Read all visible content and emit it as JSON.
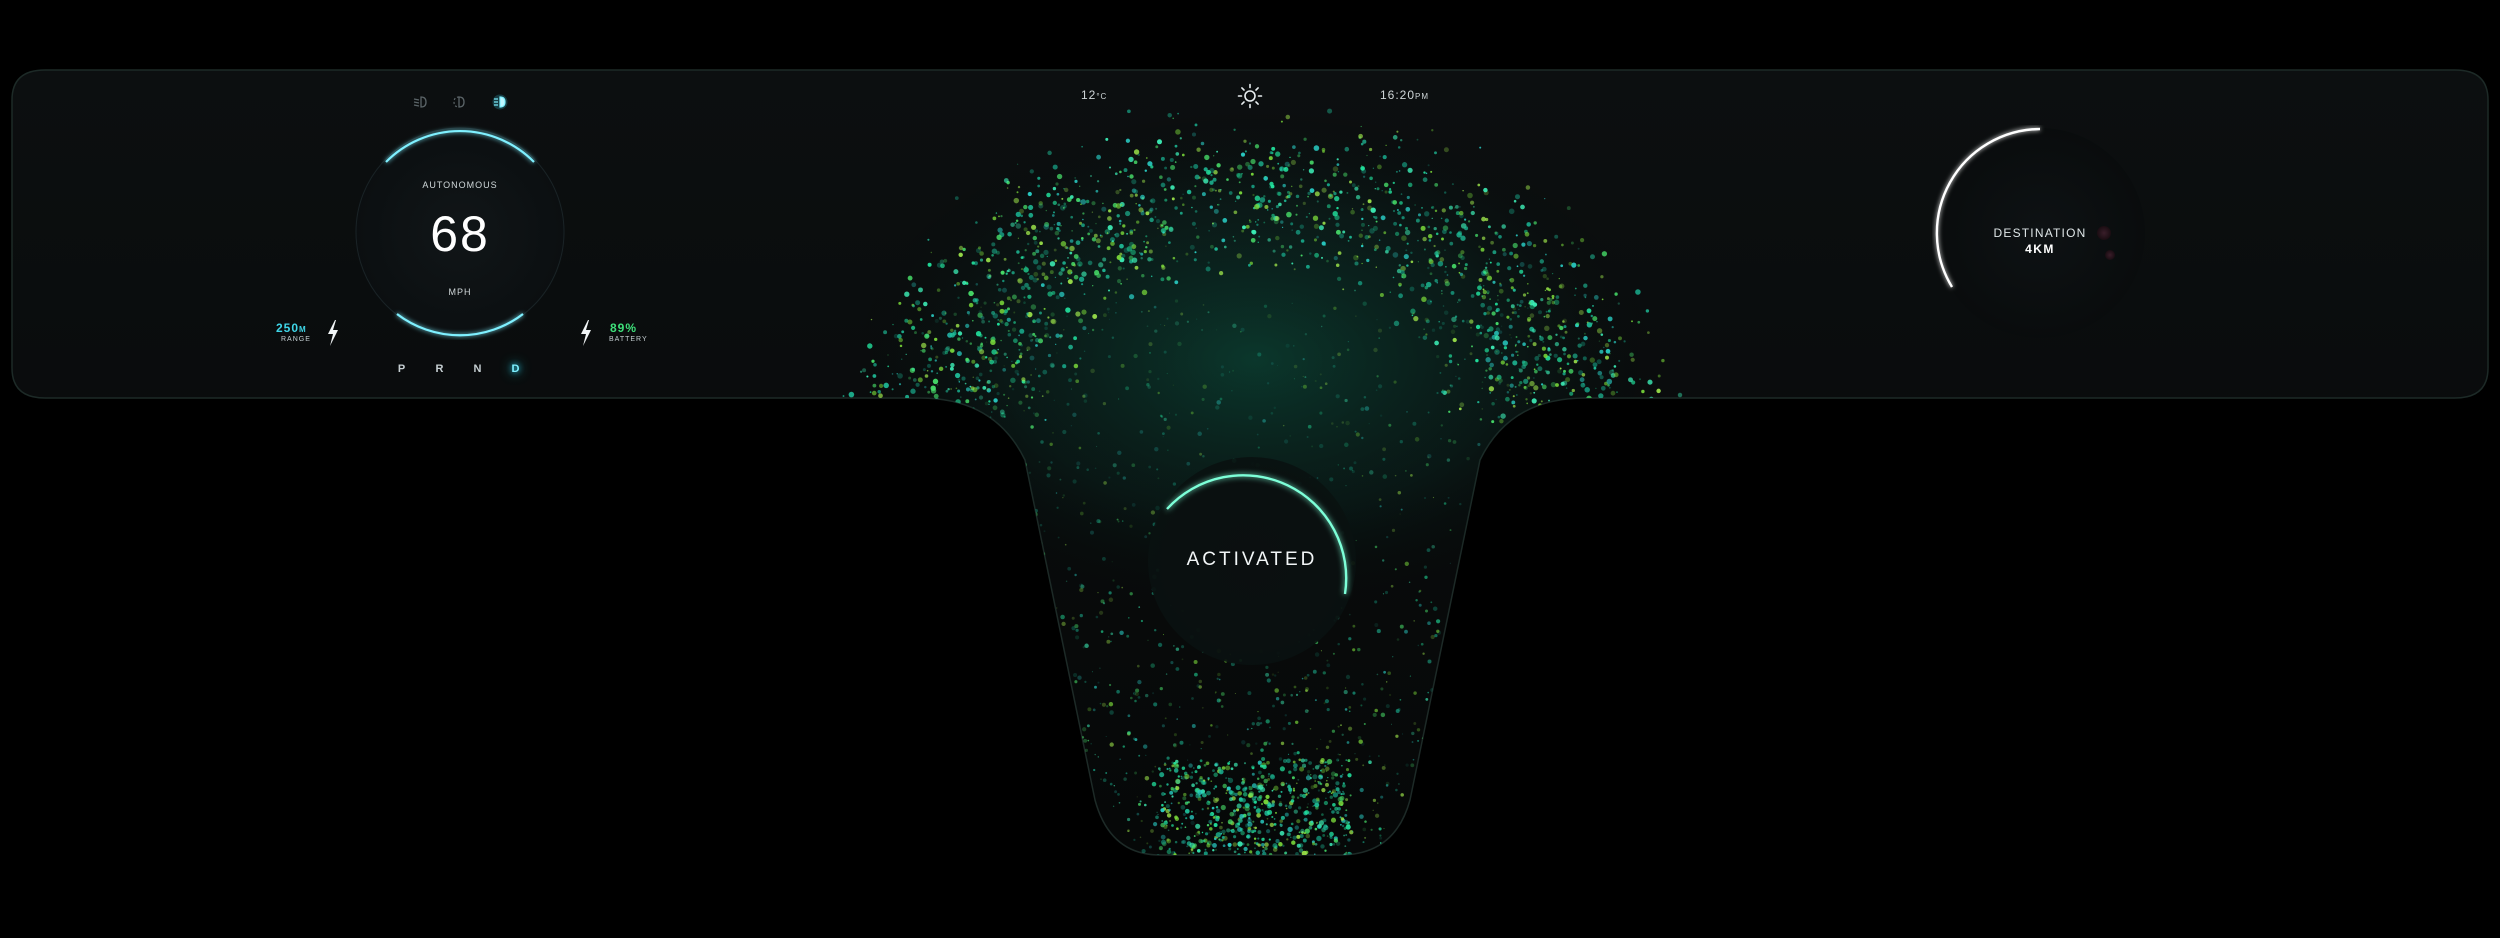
{
  "status_bar": {
    "temperature_value": "12",
    "temperature_unit": "°C",
    "time_value": "16:20",
    "time_unit": "PM",
    "weather_icon": "sun-icon"
  },
  "lights": {
    "icons": [
      "low-beam-icon",
      "parking-light-icon",
      "high-beam-icon"
    ],
    "active": "high-beam-icon"
  },
  "speedometer": {
    "mode_label": "AUTONOMOUS",
    "speed": "68",
    "unit": "MPH"
  },
  "range": {
    "value": "250",
    "unit": "M",
    "label": "RANGE"
  },
  "battery": {
    "value": "89%",
    "label": "BATTERY"
  },
  "gears": {
    "items": [
      "P",
      "R",
      "N",
      "D"
    ],
    "selected": "D"
  },
  "destination": {
    "label": "DESTINATION",
    "value": "4KM"
  },
  "autopilot": {
    "status": "ACTIVATED"
  },
  "colors": {
    "accent_cyan": "#3fd6e8",
    "battery_green": "#3ee07a",
    "particle_green": "#1fe08a",
    "background": "#000000"
  }
}
